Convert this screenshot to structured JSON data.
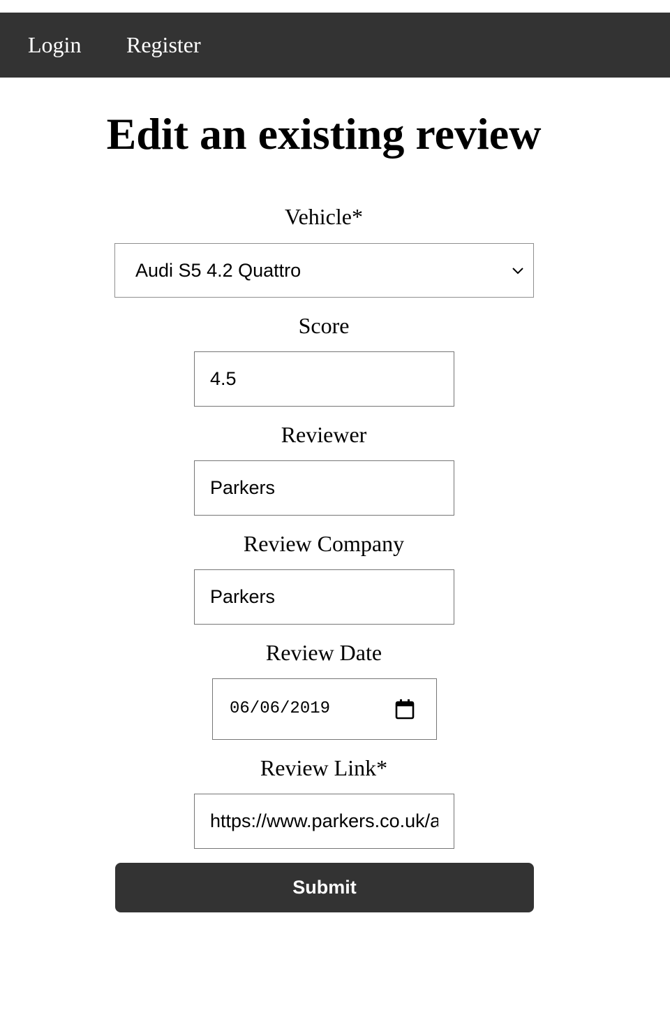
{
  "nav": {
    "login_label": "Login",
    "register_label": "Register",
    "background_color": "#333333"
  },
  "page": {
    "title": "Edit an existing review"
  },
  "form": {
    "vehicle": {
      "label": "Vehicle*",
      "selected_value": "Audi S5 4.2 Quattro"
    },
    "score": {
      "label": "Score",
      "value": "4.5"
    },
    "reviewer": {
      "label": "Reviewer",
      "value": "Parkers"
    },
    "review_company": {
      "label": "Review Company",
      "value": "Parkers"
    },
    "review_date": {
      "label": "Review Date",
      "value": "06/06/2019",
      "icon": "calendar-icon"
    },
    "review_link": {
      "label": "Review Link*",
      "value": "https://www.parkers.co.uk/a"
    },
    "submit_label": "Submit"
  }
}
